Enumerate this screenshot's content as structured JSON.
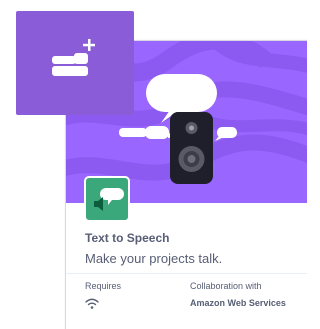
{
  "add_extension": {
    "icon": "add-extension-icon",
    "color": "#8a5cd8"
  },
  "card": {
    "art_color": "#9966ff",
    "art_image": "speaker-with-speech-bubbles",
    "icon": "text-to-speech-icon",
    "icon_color": "#3aa87a",
    "title": "Text to Speech",
    "description": "Make your projects talk.",
    "requires_label": "Requires",
    "requires_icon": "wifi-icon",
    "collaboration_label": "Collaboration with",
    "collaboration_value": "Amazon Web Services"
  }
}
